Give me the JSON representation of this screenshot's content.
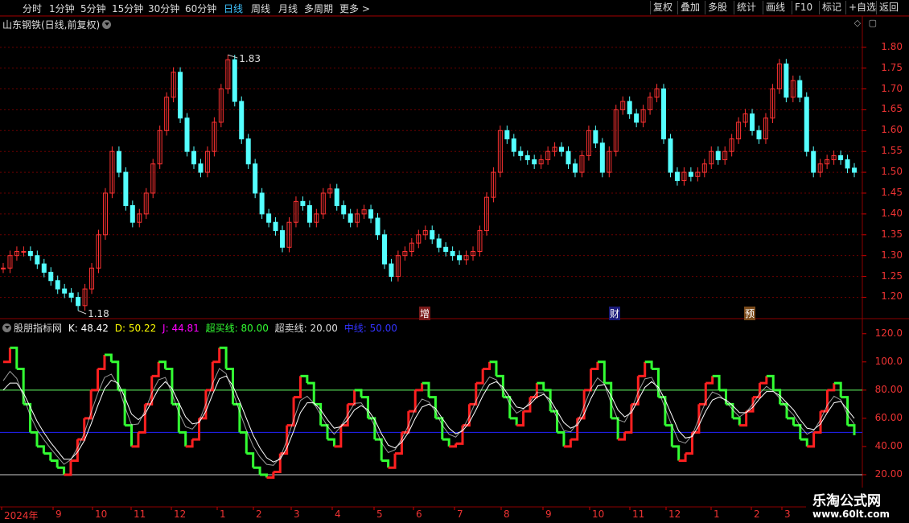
{
  "toolbar": {
    "periods": [
      "分时",
      "1分钟",
      "5分钟",
      "15分钟",
      "30分钟",
      "60分钟",
      "日线",
      "周线",
      "月线",
      "多周期",
      "更多 >"
    ],
    "active_period": "日线",
    "buttons": [
      "复权",
      "叠加",
      "多股",
      "统计",
      "画线",
      "F10",
      "标记",
      "+自选",
      "返回"
    ]
  },
  "chart_title": "山东钢铁(日线,前复权)",
  "price_axis": [
    "1.80",
    "1.75",
    "1.70",
    "1.65",
    "1.60",
    "1.55",
    "1.50",
    "1.45",
    "1.40",
    "1.35",
    "1.30",
    "1.25",
    "1.20"
  ],
  "high_label": "1.83",
  "low_label": "1.18",
  "events": [
    "增",
    "财",
    "预"
  ],
  "indicator": {
    "name": "股朋指标网",
    "k": "K: 48.42",
    "d": "D: 50.22",
    "j": "J: 44.81",
    "overbought": "超买线: 80.00",
    "oversold": "超卖线: 20.00",
    "mid": "中线: 50.00",
    "axis": [
      "120.0",
      "100.0",
      "80.00",
      "60.00",
      "40.00",
      "20.00"
    ]
  },
  "date_axis": [
    "2024年",
    "9",
    "10",
    "11",
    "12",
    "1",
    "2",
    "3",
    "4",
    "5",
    "6",
    "7",
    "8",
    "9",
    "10",
    "11",
    "12",
    "1",
    "2",
    "3"
  ],
  "watermark": {
    "line1": "乐淘公式网",
    "line2": "www.60lt.com"
  },
  "chart_data": {
    "type": "line",
    "price": {
      "ylim": [
        1.17,
        1.84
      ],
      "series": [
        {
          "values": [
            1.27,
            1.3,
            1.31,
            1.31,
            1.3,
            1.28,
            1.26,
            1.24,
            1.22,
            1.21,
            1.2,
            1.18,
            1.22,
            1.27,
            1.35,
            1.45,
            1.55,
            1.5,
            1.42,
            1.38,
            1.4,
            1.45,
            1.52,
            1.6,
            1.68,
            1.74,
            1.63,
            1.55,
            1.52,
            1.5,
            1.55,
            1.62,
            1.7,
            1.77,
            1.67,
            1.58,
            1.52,
            1.45,
            1.4,
            1.38,
            1.36,
            1.32,
            1.38,
            1.43,
            1.42,
            1.38,
            1.4,
            1.45,
            1.46,
            1.42,
            1.4,
            1.38,
            1.4,
            1.41,
            1.39,
            1.35,
            1.28,
            1.25,
            1.3,
            1.31,
            1.33,
            1.35,
            1.36,
            1.34,
            1.32,
            1.31,
            1.3,
            1.29,
            1.3,
            1.31,
            1.36,
            1.44,
            1.5,
            1.6,
            1.58,
            1.55,
            1.54,
            1.53,
            1.52,
            1.53,
            1.55,
            1.56,
            1.55,
            1.52,
            1.5,
            1.54,
            1.6,
            1.57,
            1.5,
            1.55,
            1.65,
            1.67,
            1.64,
            1.62,
            1.65,
            1.68,
            1.7,
            1.58,
            1.5,
            1.48,
            1.5,
            1.49,
            1.5,
            1.52,
            1.55,
            1.53,
            1.55,
            1.58,
            1.62,
            1.64,
            1.6,
            1.58,
            1.63,
            1.7,
            1.76,
            1.68,
            1.72,
            1.68,
            1.55,
            1.5,
            1.52,
            1.53,
            1.54,
            1.53,
            1.51,
            1.5
          ]
        }
      ]
    },
    "indicator": {
      "ylim": [
        0,
        125
      ],
      "hlines": [
        80,
        50,
        20
      ],
      "series": [
        {
          "name": "K",
          "values": [
            100,
            110,
            95,
            70,
            50,
            40,
            35,
            30,
            25,
            20,
            30,
            45,
            60,
            80,
            95,
            105,
            100,
            80,
            55,
            40,
            50,
            70,
            90,
            100,
            95,
            70,
            50,
            40,
            45,
            60,
            80,
            100,
            110,
            95,
            70,
            50,
            35,
            25,
            20,
            18,
            22,
            35,
            55,
            75,
            90,
            85,
            70,
            55,
            45,
            40,
            55,
            70,
            80,
            75,
            60,
            45,
            30,
            25,
            35,
            50,
            65,
            80,
            85,
            75,
            60,
            45,
            40,
            42,
            55,
            70,
            85,
            95,
            100,
            90,
            75,
            60,
            55,
            65,
            75,
            85,
            80,
            65,
            50,
            40,
            45,
            60,
            80,
            95,
            100,
            85,
            60,
            45,
            50,
            70,
            90,
            100,
            95,
            75,
            55,
            40,
            30,
            35,
            50,
            70,
            85,
            90,
            80,
            70,
            60,
            55,
            65,
            75,
            85,
            90,
            80,
            70,
            60,
            55,
            45,
            40,
            50,
            65,
            80,
            85,
            75,
            55,
            48
          ]
        },
        {
          "name": "D",
          "values": [
            80,
            85,
            85,
            78,
            68,
            58,
            50,
            43,
            37,
            31,
            31,
            36,
            44,
            56,
            69,
            81,
            87,
            85,
            75,
            63,
            59,
            63,
            72,
            81,
            86,
            81,
            71,
            61,
            56,
            57,
            65,
            77,
            88,
            90,
            83,
            72,
            60,
            48,
            39,
            32,
            29,
            31,
            39,
            51,
            64,
            71,
            71,
            66,
            59,
            53,
            54,
            59,
            66,
            69,
            66,
            59,
            49,
            41,
            39,
            43,
            50,
            60,
            68,
            70,
            67,
            60,
            53,
            49,
            51,
            57,
            66,
            76,
            84,
            86,
            82,
            75,
            68,
            67,
            70,
            75,
            77,
            73,
            65,
            57,
            53,
            55,
            63,
            74,
            83,
            84,
            76,
            66,
            61,
            64,
            73,
            82,
            86,
            82,
            73,
            62,
            51,
            46,
            47,
            55,
            65,
            73,
            75,
            73,
            69,
            64,
            64,
            68,
            74,
            79,
            79,
            76,
            71,
            66,
            59,
            53,
            52,
            56,
            64,
            71,
            72,
            66,
            60
          ]
        }
      ]
    }
  }
}
